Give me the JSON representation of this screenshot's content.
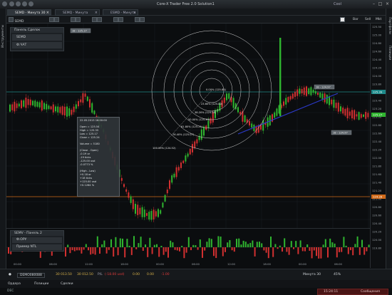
{
  "window": {
    "title": "Core-X Trader Free 2.0",
    "subtitle": "Solution1",
    "user": "Cool"
  },
  "tabs": [
    {
      "label": "SEMD - Минута 30"
    },
    {
      "label": "SEMQ - Минута"
    },
    {
      "label": "ESMD - Минута"
    }
  ],
  "toolbar": {
    "symbol": "SEMD",
    "buttons": [
      "Bar",
      "Sell",
      "Mkt"
    ]
  },
  "left_strip": {
    "label": "Инструменты"
  },
  "right_strip": {
    "labels": [
      "Портфели",
      "Позиции"
    ]
  },
  "panels": {
    "main": {
      "header": "Панель Сделок",
      "row1": "SEMD",
      "row2": "Ф.ЧАТ"
    },
    "lower": {
      "header": "SEMV - Панель 2",
      "row1": "Ф.ОРУ",
      "row2": "Пример NTL"
    }
  },
  "chart_data": {
    "type": "candlestick",
    "price_labels": [
      "125.50",
      "125.00",
      "124.80",
      "124.60",
      "124.40",
      "124.20",
      "124.00",
      "123.80",
      "123.60",
      "123.40",
      "123.20",
      "123.00",
      "122.80",
      "122.60",
      "122.40",
      "122.20",
      "122.00",
      "121.80",
      "121.60",
      "121.40",
      "121.20",
      "121.00",
      "120.80",
      "120.60",
      "120.40",
      "120.20",
      "120.00",
      "119.80"
    ],
    "time_labels": [
      "00:00",
      "06:00",
      "12:00",
      "18:00",
      "00:00",
      "06:00",
      "12:00",
      "18:00",
      "00:00",
      "06:00",
      "12:00"
    ],
    "horizontal_lines": {
      "teal": "125.39",
      "orange": "124.28"
    },
    "current_price": "125.27",
    "annotations": [
      "18 - 125.17",
      "18 - 124.97",
      "18 - 124.97"
    ],
    "fib_labels": [
      "0.00%",
      "23.60%",
      "38.20%",
      "50.00%",
      "61.80%",
      "76.40%",
      "100.00%"
    ],
    "fib_values": [
      "(125.88)",
      "(125.80)",
      "(125.56)",
      "(125.39)",
      "(125.21)",
      "(125.07)",
      "(124.52)"
    ],
    "tooltip": {
      "date": "22.05.2013 16:00:00",
      "open": "Open = 125.54",
      "high": "High = 125.35",
      "low": "Low = 125.17",
      "close": "Close = 125.24",
      "volume": "Volume = 5180",
      "change_title": "(Close - Open)",
      "change_lines": [
        "-0.19 or",
        "-19 ticks",
        "-125.00 usd",
        "-0.0773 %"
      ],
      "range_title": "(High - Low)",
      "range_lines": [
        "+0.18 or",
        "+18 ticks",
        "+125.00 usd",
        "+0.1264 %"
      ]
    }
  },
  "status": {
    "account": "DEMO080088",
    "balance": "30 013.50",
    "equity": "30 012.50",
    "pnl_label": "P/L",
    "pnl": "(-18.00 usd)",
    "margin": "0.00",
    "margin_used": "0.00",
    "risk": "-1.00",
    "timeframe": "Минута 30",
    "zoom": "45%"
  },
  "bottom_tabs": [
    "Ордера",
    "Позиции",
    "Сделки"
  ],
  "footer": {
    "left": "DEC",
    "time": "15:24:11",
    "messages": "Сообщения"
  },
  "colors": {
    "up": "#2fb52f",
    "down": "#d23030",
    "teal": "#1e8a8a",
    "orange": "#d06a1a",
    "bg": "#0b0d0f"
  }
}
